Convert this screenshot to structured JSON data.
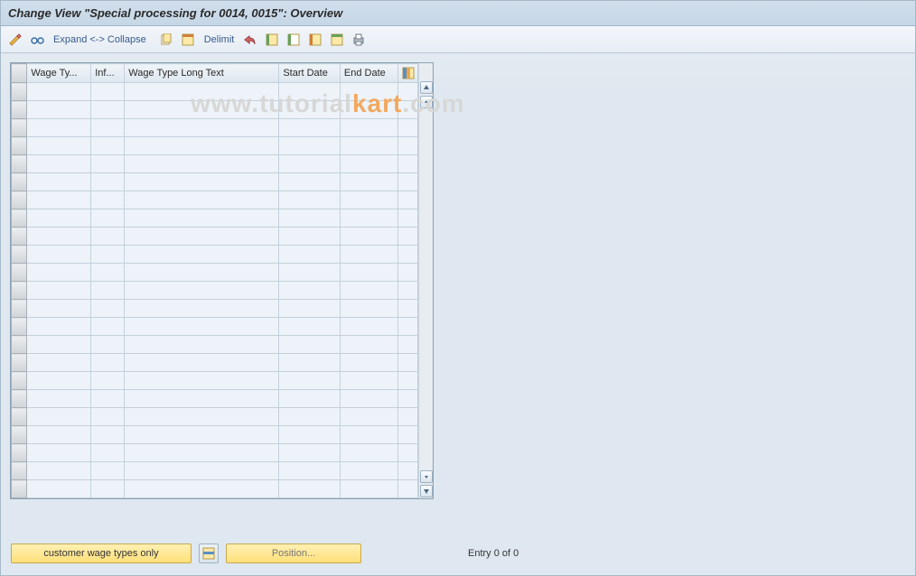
{
  "title": "Change View \"Special processing for 0014, 0015\": Overview",
  "toolbar": {
    "expand_collapse": "Expand <-> Collapse",
    "delimit": "Delimit"
  },
  "columns": {
    "wage_type": "Wage Ty...",
    "inf": "Inf...",
    "long_text": "Wage Type Long Text",
    "start_date": "Start Date",
    "end_date": "End Date"
  },
  "rows": [
    {
      "wage_type": "",
      "inf": "",
      "long_text": "",
      "start": "",
      "end": ""
    },
    {
      "wage_type": "",
      "inf": "",
      "long_text": "",
      "start": "",
      "end": ""
    },
    {
      "wage_type": "",
      "inf": "",
      "long_text": "",
      "start": "",
      "end": ""
    },
    {
      "wage_type": "",
      "inf": "",
      "long_text": "",
      "start": "",
      "end": ""
    },
    {
      "wage_type": "",
      "inf": "",
      "long_text": "",
      "start": "",
      "end": ""
    },
    {
      "wage_type": "",
      "inf": "",
      "long_text": "",
      "start": "",
      "end": ""
    },
    {
      "wage_type": "",
      "inf": "",
      "long_text": "",
      "start": "",
      "end": ""
    },
    {
      "wage_type": "",
      "inf": "",
      "long_text": "",
      "start": "",
      "end": ""
    },
    {
      "wage_type": "",
      "inf": "",
      "long_text": "",
      "start": "",
      "end": ""
    },
    {
      "wage_type": "",
      "inf": "",
      "long_text": "",
      "start": "",
      "end": ""
    },
    {
      "wage_type": "",
      "inf": "",
      "long_text": "",
      "start": "",
      "end": ""
    },
    {
      "wage_type": "",
      "inf": "",
      "long_text": "",
      "start": "",
      "end": ""
    },
    {
      "wage_type": "",
      "inf": "",
      "long_text": "",
      "start": "",
      "end": ""
    },
    {
      "wage_type": "",
      "inf": "",
      "long_text": "",
      "start": "",
      "end": ""
    },
    {
      "wage_type": "",
      "inf": "",
      "long_text": "",
      "start": "",
      "end": ""
    },
    {
      "wage_type": "",
      "inf": "",
      "long_text": "",
      "start": "",
      "end": ""
    },
    {
      "wage_type": "",
      "inf": "",
      "long_text": "",
      "start": "",
      "end": ""
    },
    {
      "wage_type": "",
      "inf": "",
      "long_text": "",
      "start": "",
      "end": ""
    },
    {
      "wage_type": "",
      "inf": "",
      "long_text": "",
      "start": "",
      "end": ""
    },
    {
      "wage_type": "",
      "inf": "",
      "long_text": "",
      "start": "",
      "end": ""
    },
    {
      "wage_type": "",
      "inf": "",
      "long_text": "",
      "start": "",
      "end": ""
    },
    {
      "wage_type": "",
      "inf": "",
      "long_text": "",
      "start": "",
      "end": ""
    },
    {
      "wage_type": "",
      "inf": "",
      "long_text": "",
      "start": "",
      "end": ""
    }
  ],
  "footer": {
    "customer_btn": "customer wage types only",
    "position_btn": "Position...",
    "entry_text": "Entry 0 of 0"
  },
  "watermark": {
    "prefix": "www.tutorial",
    "suffix": "kart",
    "tld": ".com"
  }
}
